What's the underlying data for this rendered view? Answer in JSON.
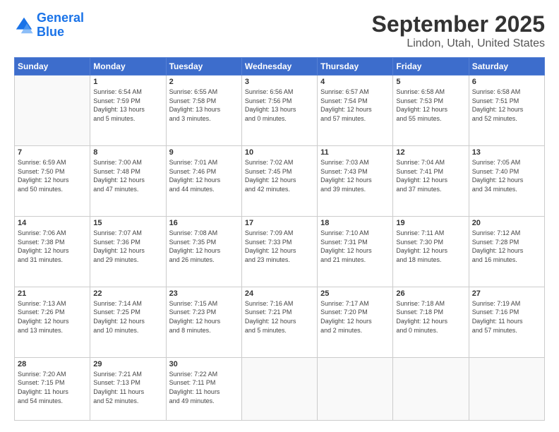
{
  "header": {
    "logo_line1": "General",
    "logo_line2": "Blue",
    "month": "September 2025",
    "location": "Lindon, Utah, United States"
  },
  "days_of_week": [
    "Sunday",
    "Monday",
    "Tuesday",
    "Wednesday",
    "Thursday",
    "Friday",
    "Saturday"
  ],
  "weeks": [
    [
      {
        "day": "",
        "info": ""
      },
      {
        "day": "1",
        "info": "Sunrise: 6:54 AM\nSunset: 7:59 PM\nDaylight: 13 hours\nand 5 minutes."
      },
      {
        "day": "2",
        "info": "Sunrise: 6:55 AM\nSunset: 7:58 PM\nDaylight: 13 hours\nand 3 minutes."
      },
      {
        "day": "3",
        "info": "Sunrise: 6:56 AM\nSunset: 7:56 PM\nDaylight: 13 hours\nand 0 minutes."
      },
      {
        "day": "4",
        "info": "Sunrise: 6:57 AM\nSunset: 7:54 PM\nDaylight: 12 hours\nand 57 minutes."
      },
      {
        "day": "5",
        "info": "Sunrise: 6:58 AM\nSunset: 7:53 PM\nDaylight: 12 hours\nand 55 minutes."
      },
      {
        "day": "6",
        "info": "Sunrise: 6:58 AM\nSunset: 7:51 PM\nDaylight: 12 hours\nand 52 minutes."
      }
    ],
    [
      {
        "day": "7",
        "info": "Sunrise: 6:59 AM\nSunset: 7:50 PM\nDaylight: 12 hours\nand 50 minutes."
      },
      {
        "day": "8",
        "info": "Sunrise: 7:00 AM\nSunset: 7:48 PM\nDaylight: 12 hours\nand 47 minutes."
      },
      {
        "day": "9",
        "info": "Sunrise: 7:01 AM\nSunset: 7:46 PM\nDaylight: 12 hours\nand 44 minutes."
      },
      {
        "day": "10",
        "info": "Sunrise: 7:02 AM\nSunset: 7:45 PM\nDaylight: 12 hours\nand 42 minutes."
      },
      {
        "day": "11",
        "info": "Sunrise: 7:03 AM\nSunset: 7:43 PM\nDaylight: 12 hours\nand 39 minutes."
      },
      {
        "day": "12",
        "info": "Sunrise: 7:04 AM\nSunset: 7:41 PM\nDaylight: 12 hours\nand 37 minutes."
      },
      {
        "day": "13",
        "info": "Sunrise: 7:05 AM\nSunset: 7:40 PM\nDaylight: 12 hours\nand 34 minutes."
      }
    ],
    [
      {
        "day": "14",
        "info": "Sunrise: 7:06 AM\nSunset: 7:38 PM\nDaylight: 12 hours\nand 31 minutes."
      },
      {
        "day": "15",
        "info": "Sunrise: 7:07 AM\nSunset: 7:36 PM\nDaylight: 12 hours\nand 29 minutes."
      },
      {
        "day": "16",
        "info": "Sunrise: 7:08 AM\nSunset: 7:35 PM\nDaylight: 12 hours\nand 26 minutes."
      },
      {
        "day": "17",
        "info": "Sunrise: 7:09 AM\nSunset: 7:33 PM\nDaylight: 12 hours\nand 23 minutes."
      },
      {
        "day": "18",
        "info": "Sunrise: 7:10 AM\nSunset: 7:31 PM\nDaylight: 12 hours\nand 21 minutes."
      },
      {
        "day": "19",
        "info": "Sunrise: 7:11 AM\nSunset: 7:30 PM\nDaylight: 12 hours\nand 18 minutes."
      },
      {
        "day": "20",
        "info": "Sunrise: 7:12 AM\nSunset: 7:28 PM\nDaylight: 12 hours\nand 16 minutes."
      }
    ],
    [
      {
        "day": "21",
        "info": "Sunrise: 7:13 AM\nSunset: 7:26 PM\nDaylight: 12 hours\nand 13 minutes."
      },
      {
        "day": "22",
        "info": "Sunrise: 7:14 AM\nSunset: 7:25 PM\nDaylight: 12 hours\nand 10 minutes."
      },
      {
        "day": "23",
        "info": "Sunrise: 7:15 AM\nSunset: 7:23 PM\nDaylight: 12 hours\nand 8 minutes."
      },
      {
        "day": "24",
        "info": "Sunrise: 7:16 AM\nSunset: 7:21 PM\nDaylight: 12 hours\nand 5 minutes."
      },
      {
        "day": "25",
        "info": "Sunrise: 7:17 AM\nSunset: 7:20 PM\nDaylight: 12 hours\nand 2 minutes."
      },
      {
        "day": "26",
        "info": "Sunrise: 7:18 AM\nSunset: 7:18 PM\nDaylight: 12 hours\nand 0 minutes."
      },
      {
        "day": "27",
        "info": "Sunrise: 7:19 AM\nSunset: 7:16 PM\nDaylight: 11 hours\nand 57 minutes."
      }
    ],
    [
      {
        "day": "28",
        "info": "Sunrise: 7:20 AM\nSunset: 7:15 PM\nDaylight: 11 hours\nand 54 minutes."
      },
      {
        "day": "29",
        "info": "Sunrise: 7:21 AM\nSunset: 7:13 PM\nDaylight: 11 hours\nand 52 minutes."
      },
      {
        "day": "30",
        "info": "Sunrise: 7:22 AM\nSunset: 7:11 PM\nDaylight: 11 hours\nand 49 minutes."
      },
      {
        "day": "",
        "info": ""
      },
      {
        "day": "",
        "info": ""
      },
      {
        "day": "",
        "info": ""
      },
      {
        "day": "",
        "info": ""
      }
    ]
  ]
}
